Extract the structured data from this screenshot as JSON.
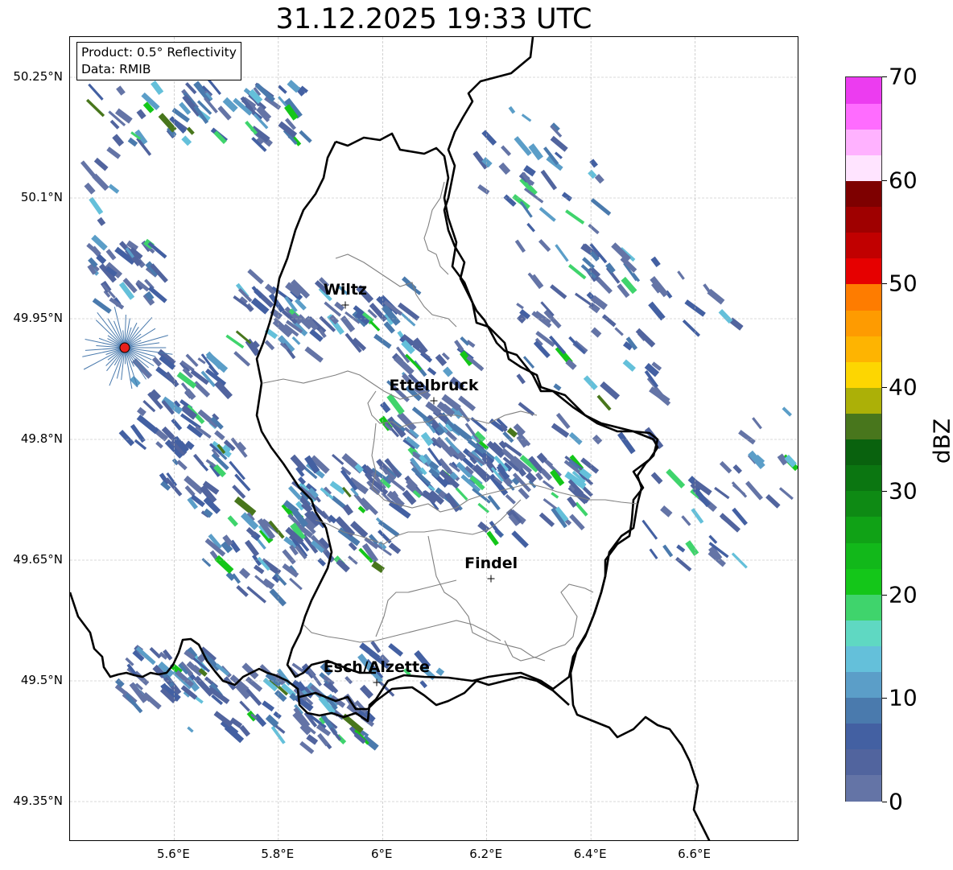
{
  "title": "31.12.2025 19:33 UTC",
  "infobox": {
    "product": "Product: 0.5° Reflectivity",
    "source": "Data: RMIB"
  },
  "axes": {
    "lat_labels": [
      "50.25°N",
      "50.1°N",
      "49.95°N",
      "49.8°N",
      "49.65°N",
      "49.5°N",
      "49.35°N"
    ],
    "lat_values": [
      50.25,
      50.1,
      49.95,
      49.8,
      49.65,
      49.5,
      49.35
    ],
    "lon_labels": [
      "5.6°E",
      "5.8°E",
      "6°E",
      "6.2°E",
      "6.4°E",
      "6.6°E"
    ],
    "lon_values": [
      5.6,
      5.8,
      6.0,
      6.2,
      6.4,
      6.6
    ],
    "lat_range": [
      49.3,
      50.3
    ],
    "lon_range": [
      5.4,
      6.8
    ]
  },
  "cities": [
    {
      "name": "Wiltz",
      "lon": 5.93,
      "lat": 49.966
    },
    {
      "name": "Ettelbruck",
      "lon": 6.1,
      "lat": 49.847
    },
    {
      "name": "Findel",
      "lon": 6.21,
      "lat": 49.626
    },
    {
      "name": "Esch/Alzette",
      "lon": 5.99,
      "lat": 49.497
    }
  ],
  "radar_site": {
    "lon": 5.505,
    "lat": 49.914,
    "color": "#e8201c"
  },
  "colorbar": {
    "unit": "dBZ",
    "min": 0,
    "max": 70,
    "tick_labels": [
      "0",
      "10",
      "20",
      "30",
      "40",
      "50",
      "60",
      "70"
    ],
    "tick_values": [
      0,
      10,
      20,
      30,
      40,
      50,
      60,
      70
    ],
    "colors": [
      "#6474a6",
      "#51649e",
      "#4360a2",
      "#4a7aad",
      "#5b9ec8",
      "#64c0da",
      "#5fd8c2",
      "#3fd46c",
      "#14c619",
      "#12b81a",
      "#10a216",
      "#0e8a14",
      "#0b7611",
      "#09620e",
      "#48761c",
      "#acb007",
      "#fdd601",
      "#feb401",
      "#fe9b01",
      "#fe7c00",
      "#e60000",
      "#c10000",
      "#9f0000",
      "#7e0000",
      "#ffe4ff",
      "#ffb2ff",
      "#ff6cff",
      "#ec3cf0"
    ]
  },
  "gridlines": true,
  "colors": {
    "border": "#000000",
    "canton": "#808080",
    "grid": "#b3b3b3"
  }
}
